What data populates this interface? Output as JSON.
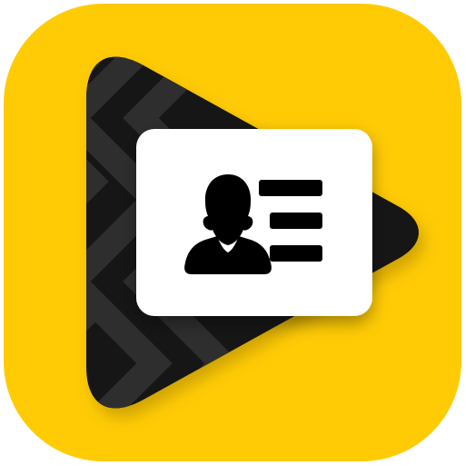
{
  "app_icon": {
    "glyph": "play-triangle-with-contact-card",
    "colors": {
      "tile": "#FFCB05",
      "tile_shadow": "#E8B800",
      "play_dark": "#161616",
      "play_stripe": "#2E2E2E",
      "card": "#FFFFFF",
      "card_glyph": "#000000"
    },
    "elements": {
      "background": "rounded-square-tile",
      "play": "play-icon",
      "card": "contact-card",
      "person": "person-silhouette-icon",
      "lines": "list-lines-icon"
    }
  }
}
